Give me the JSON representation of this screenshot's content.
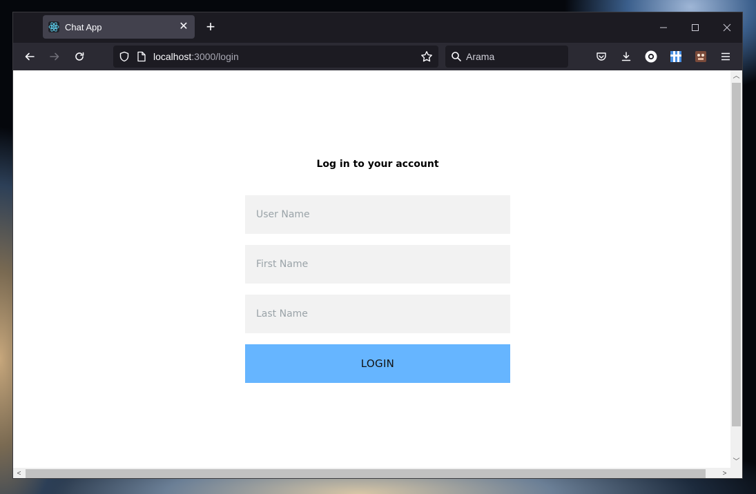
{
  "browser": {
    "tab": {
      "title": "Chat App",
      "favicon": "react-icon",
      "close_glyph": "✕"
    },
    "new_tab_glyph": "+",
    "url": {
      "host": "localhost",
      "path": ":3000/login"
    },
    "search": {
      "placeholder": "Arama"
    },
    "window_controls": [
      "minimize-icon",
      "maximize-icon",
      "close-icon"
    ],
    "toolbar_icons": [
      "pocket-icon",
      "download-icon",
      "extension-o-icon",
      "extension-grid-icon",
      "extension-avatar-icon",
      "menu-icon"
    ],
    "theme": {
      "tabstrip": "#1c1b22",
      "navbar": "#2b2a33",
      "urlbar": "#1c1b22",
      "active_tab": "#42414d"
    }
  },
  "page": {
    "title": "Log in to your account",
    "fields": [
      {
        "name": "username-input",
        "placeholder": "User Name",
        "value": ""
      },
      {
        "name": "firstname-input",
        "placeholder": "First Name",
        "value": ""
      },
      {
        "name": "lastname-input",
        "placeholder": "Last Name",
        "value": ""
      }
    ],
    "login_label": "LOGIN",
    "colors": {
      "input_bg": "#f2f2f2",
      "button_bg": "#66b5ff",
      "placeholder": "#9aa3a8"
    }
  }
}
